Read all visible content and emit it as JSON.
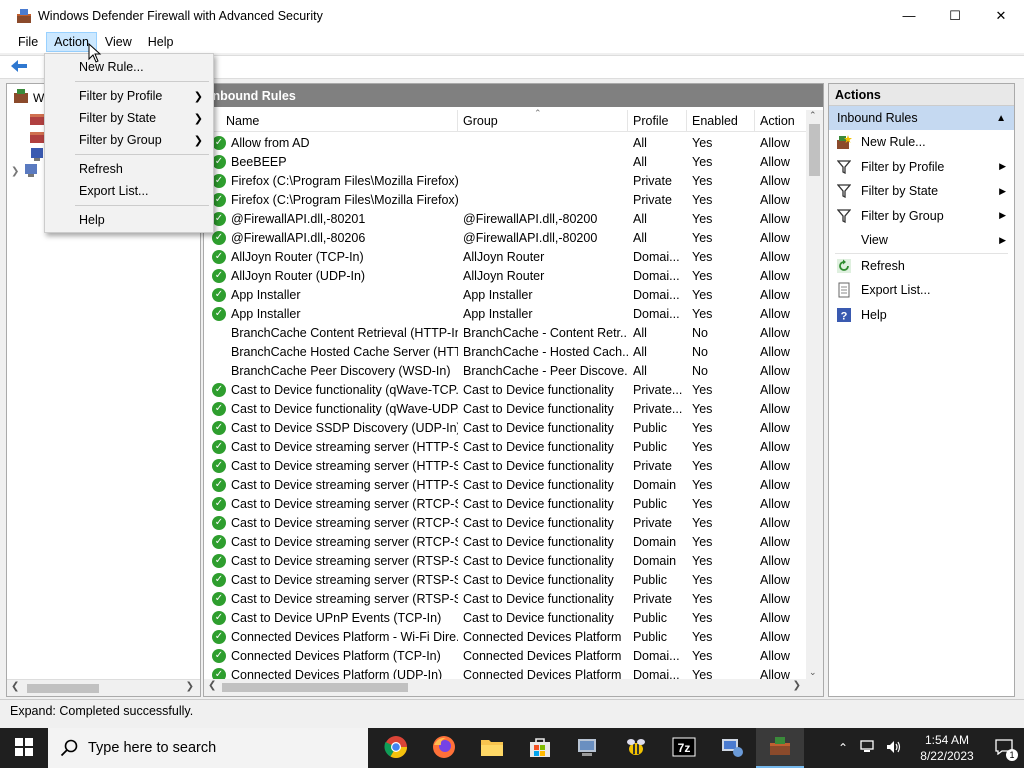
{
  "window": {
    "title": "Windows Defender Firewall with Advanced Security",
    "controls": [
      "minimize",
      "maximize",
      "close"
    ]
  },
  "menubar": {
    "items": [
      "File",
      "Action",
      "View",
      "Help"
    ]
  },
  "action_menu": {
    "items": [
      {
        "label": "New Rule...",
        "submenu": false
      },
      {
        "label": "Filter by Profile",
        "submenu": true
      },
      {
        "label": "Filter by State",
        "submenu": true
      },
      {
        "label": "Filter by Group",
        "submenu": true
      },
      {
        "label": "Refresh",
        "submenu": false
      },
      {
        "label": "Export List...",
        "submenu": false
      },
      {
        "label": "Help",
        "submenu": false
      }
    ]
  },
  "tree": {
    "root_label": "W"
  },
  "center": {
    "header": "Inbound Rules",
    "columns": [
      "Name",
      "Group",
      "Profile",
      "Enabled",
      "Action"
    ],
    "rows": [
      {
        "enabled_icon": true,
        "name": "Allow from AD",
        "group": "",
        "profile": "All",
        "enabled": "Yes",
        "action": "Allow"
      },
      {
        "enabled_icon": true,
        "name": "BeeBEEP",
        "group": "",
        "profile": "All",
        "enabled": "Yes",
        "action": "Allow"
      },
      {
        "enabled_icon": true,
        "name": "Firefox (C:\\Program Files\\Mozilla Firefox)",
        "group": "",
        "profile": "Private",
        "enabled": "Yes",
        "action": "Allow"
      },
      {
        "enabled_icon": true,
        "name": "Firefox (C:\\Program Files\\Mozilla Firefox)",
        "group": "",
        "profile": "Private",
        "enabled": "Yes",
        "action": "Allow"
      },
      {
        "enabled_icon": true,
        "name": "@FirewallAPI.dll,-80201",
        "group": "@FirewallAPI.dll,-80200",
        "profile": "All",
        "enabled": "Yes",
        "action": "Allow"
      },
      {
        "enabled_icon": true,
        "name": "@FirewallAPI.dll,-80206",
        "group": "@FirewallAPI.dll,-80200",
        "profile": "All",
        "enabled": "Yes",
        "action": "Allow"
      },
      {
        "enabled_icon": true,
        "name": "AllJoyn Router (TCP-In)",
        "group": "AllJoyn Router",
        "profile": "Domai...",
        "enabled": "Yes",
        "action": "Allow"
      },
      {
        "enabled_icon": true,
        "name": "AllJoyn Router (UDP-In)",
        "group": "AllJoyn Router",
        "profile": "Domai...",
        "enabled": "Yes",
        "action": "Allow"
      },
      {
        "enabled_icon": true,
        "name": "App Installer",
        "group": "App Installer",
        "profile": "Domai...",
        "enabled": "Yes",
        "action": "Allow"
      },
      {
        "enabled_icon": true,
        "name": "App Installer",
        "group": "App Installer",
        "profile": "Domai...",
        "enabled": "Yes",
        "action": "Allow"
      },
      {
        "enabled_icon": false,
        "name": "BranchCache Content Retrieval (HTTP-In)",
        "group": "BranchCache - Content Retr...",
        "profile": "All",
        "enabled": "No",
        "action": "Allow"
      },
      {
        "enabled_icon": false,
        "name": "BranchCache Hosted Cache Server (HTTP...",
        "group": "BranchCache - Hosted Cach...",
        "profile": "All",
        "enabled": "No",
        "action": "Allow"
      },
      {
        "enabled_icon": false,
        "name": "BranchCache Peer Discovery (WSD-In)",
        "group": "BranchCache - Peer Discove...",
        "profile": "All",
        "enabled": "No",
        "action": "Allow"
      },
      {
        "enabled_icon": true,
        "name": "Cast to Device functionality (qWave-TCP...",
        "group": "Cast to Device functionality",
        "profile": "Private...",
        "enabled": "Yes",
        "action": "Allow"
      },
      {
        "enabled_icon": true,
        "name": "Cast to Device functionality (qWave-UDP...",
        "group": "Cast to Device functionality",
        "profile": "Private...",
        "enabled": "Yes",
        "action": "Allow"
      },
      {
        "enabled_icon": true,
        "name": "Cast to Device SSDP Discovery (UDP-In)",
        "group": "Cast to Device functionality",
        "profile": "Public",
        "enabled": "Yes",
        "action": "Allow"
      },
      {
        "enabled_icon": true,
        "name": "Cast to Device streaming server (HTTP-St...",
        "group": "Cast to Device functionality",
        "profile": "Public",
        "enabled": "Yes",
        "action": "Allow"
      },
      {
        "enabled_icon": true,
        "name": "Cast to Device streaming server (HTTP-St...",
        "group": "Cast to Device functionality",
        "profile": "Private",
        "enabled": "Yes",
        "action": "Allow"
      },
      {
        "enabled_icon": true,
        "name": "Cast to Device streaming server (HTTP-St...",
        "group": "Cast to Device functionality",
        "profile": "Domain",
        "enabled": "Yes",
        "action": "Allow"
      },
      {
        "enabled_icon": true,
        "name": "Cast to Device streaming server (RTCP-Str...",
        "group": "Cast to Device functionality",
        "profile": "Public",
        "enabled": "Yes",
        "action": "Allow"
      },
      {
        "enabled_icon": true,
        "name": "Cast to Device streaming server (RTCP-Str...",
        "group": "Cast to Device functionality",
        "profile": "Private",
        "enabled": "Yes",
        "action": "Allow"
      },
      {
        "enabled_icon": true,
        "name": "Cast to Device streaming server (RTCP-Str...",
        "group": "Cast to Device functionality",
        "profile": "Domain",
        "enabled": "Yes",
        "action": "Allow"
      },
      {
        "enabled_icon": true,
        "name": "Cast to Device streaming server (RTSP-Str...",
        "group": "Cast to Device functionality",
        "profile": "Domain",
        "enabled": "Yes",
        "action": "Allow"
      },
      {
        "enabled_icon": true,
        "name": "Cast to Device streaming server (RTSP-Str...",
        "group": "Cast to Device functionality",
        "profile": "Public",
        "enabled": "Yes",
        "action": "Allow"
      },
      {
        "enabled_icon": true,
        "name": "Cast to Device streaming server (RTSP-Str...",
        "group": "Cast to Device functionality",
        "profile": "Private",
        "enabled": "Yes",
        "action": "Allow"
      },
      {
        "enabled_icon": true,
        "name": "Cast to Device UPnP Events (TCP-In)",
        "group": "Cast to Device functionality",
        "profile": "Public",
        "enabled": "Yes",
        "action": "Allow"
      },
      {
        "enabled_icon": true,
        "name": "Connected Devices Platform - Wi-Fi Dire...",
        "group": "Connected Devices Platform",
        "profile": "Public",
        "enabled": "Yes",
        "action": "Allow"
      },
      {
        "enabled_icon": true,
        "name": "Connected Devices Platform (TCP-In)",
        "group": "Connected Devices Platform",
        "profile": "Domai...",
        "enabled": "Yes",
        "action": "Allow"
      },
      {
        "enabled_icon": true,
        "name": "Connected Devices Platform (UDP-In)",
        "group": "Connected Devices Platform",
        "profile": "Domai...",
        "enabled": "Yes",
        "action": "Allow"
      }
    ]
  },
  "actions_pane": {
    "header": "Actions",
    "subheader": "Inbound Rules",
    "items": [
      {
        "label": "New Rule...",
        "icon": "new-rule-icon",
        "submenu": false
      },
      {
        "label": "Filter by Profile",
        "icon": "filter-icon",
        "submenu": true
      },
      {
        "label": "Filter by State",
        "icon": "filter-icon",
        "submenu": true
      },
      {
        "label": "Filter by Group",
        "icon": "filter-icon",
        "submenu": true
      },
      {
        "label": "View",
        "icon": "",
        "submenu": true
      },
      {
        "label": "Refresh",
        "icon": "refresh-icon",
        "submenu": false
      },
      {
        "label": "Export List...",
        "icon": "export-icon",
        "submenu": false
      },
      {
        "label": "Help",
        "icon": "help-icon",
        "submenu": false
      }
    ]
  },
  "status": {
    "text": "Expand:  Completed successfully."
  },
  "taskbar": {
    "search_placeholder": "Type here to search",
    "time": "1:54 AM",
    "date": "8/22/2023",
    "notification_count": "1"
  }
}
